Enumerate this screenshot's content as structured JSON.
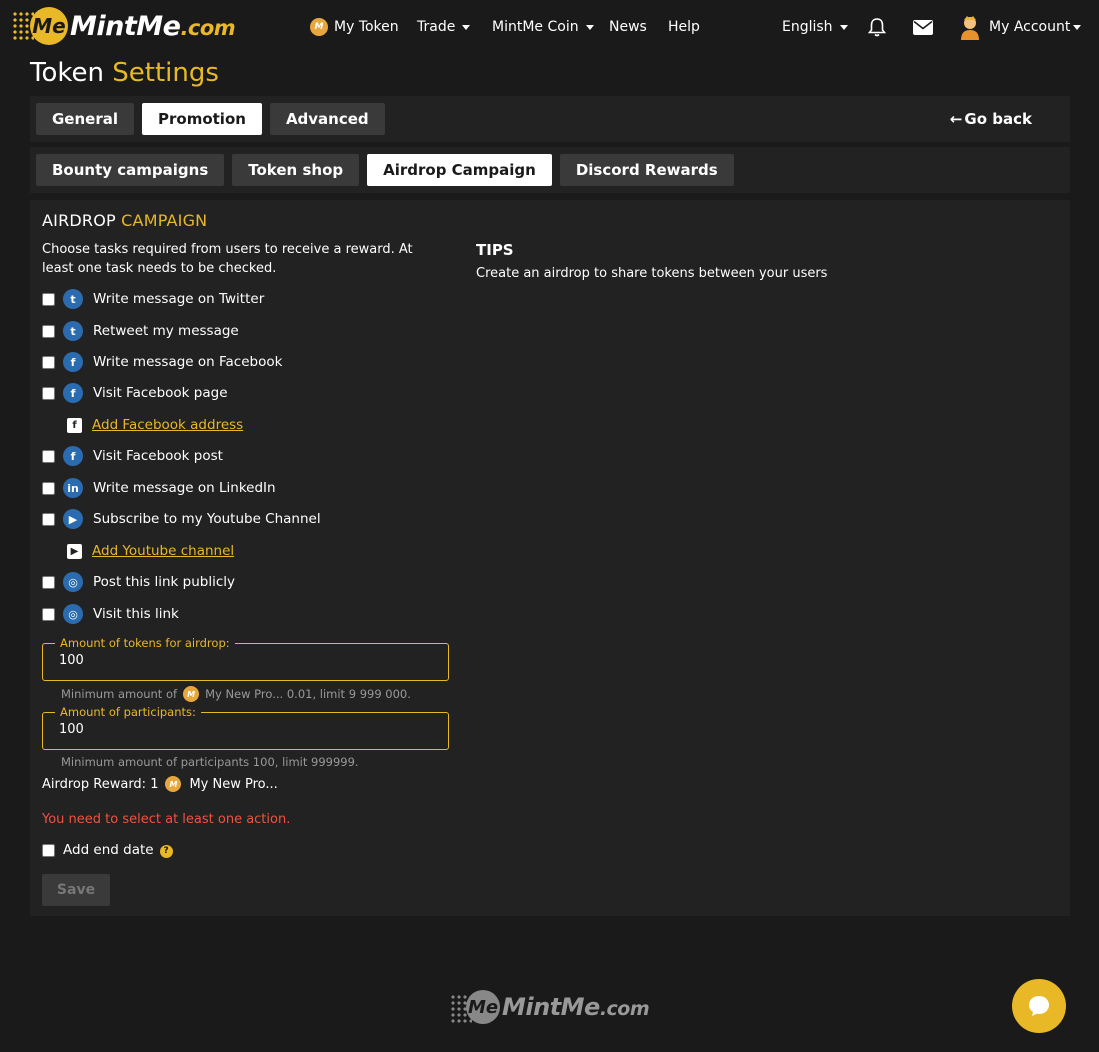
{
  "header": {
    "logo_main": "MintMe",
    "logo_domain": ".com",
    "logo_badge": "Me",
    "nav": {
      "my_token": "My Token",
      "trade": "Trade",
      "mintme_coin": "MintMe Coin",
      "news": "News",
      "help": "Help",
      "language": "English",
      "account": "My Account"
    }
  },
  "page": {
    "title_part1": "Token",
    "title_part2": "Settings"
  },
  "main_tabs": {
    "general": "General",
    "promotion": "Promotion",
    "advanced": "Advanced",
    "go_back": "Go back"
  },
  "sub_tabs": {
    "bounty": "Bounty campaigns",
    "shop": "Token shop",
    "airdrop": "Airdrop Campaign",
    "discord": "Discord Rewards"
  },
  "airdrop": {
    "title_part1": "AIRDROP",
    "title_part2": "CAMPAIGN",
    "intro": "Choose tasks required from users to receive a reward. At least one task needs to be checked.",
    "tasks": {
      "twitter_msg": "Write message on Twitter",
      "retweet": "Retweet my message",
      "facebook_msg": "Write message on Facebook",
      "facebook_page": "Visit Facebook page",
      "add_facebook": "Add Facebook address",
      "facebook_post": "Visit Facebook post",
      "linkedin_msg": "Write message on LinkedIn",
      "youtube_sub": "Subscribe to my Youtube Channel",
      "add_youtube": "Add Youtube channel",
      "post_link": "Post this link publicly",
      "visit_link": "Visit this link"
    },
    "amount_label": "Amount of tokens for airdrop:",
    "amount_value": "100",
    "amount_hint_prefix": "Minimum amount of",
    "amount_hint_suffix": "My New Pro... 0.01, limit 9 999 000.",
    "participants_label": "Amount of participants:",
    "participants_value": "100",
    "participants_hint": "Minimum amount of participants 100, limit 999999.",
    "reward_label": "Airdrop Reward: 1",
    "reward_token": "My New Pro...",
    "error": "You need to select at least one action.",
    "end_date": "Add end date",
    "save": "Save"
  },
  "tips": {
    "title": "TIPS",
    "text": "Create an airdrop to share tokens between your users"
  },
  "colors": {
    "accent": "#e8b826",
    "background": "#1a1a1a",
    "panel": "#222222",
    "error": "#f0533f",
    "social": "#2b6cb0"
  }
}
